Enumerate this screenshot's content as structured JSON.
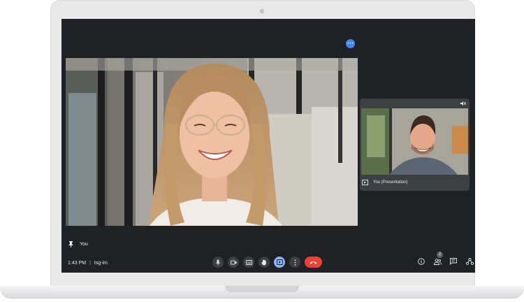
{
  "meeting": {
    "time": "1:43 PM",
    "separator": "|",
    "code": "tsg-im"
  },
  "pinned": {
    "label": "You"
  },
  "self_tile": {
    "caption": "You (Presentation)"
  },
  "people_count": "2",
  "icons": {
    "more": "more-options-icon",
    "pin": "pin-icon",
    "mic": "microphone-icon",
    "camera": "camera-icon",
    "captions": "captions-icon",
    "raise_hand": "raise-hand-icon",
    "present": "present-screen-icon",
    "more_vert": "more-vert-icon",
    "end_call": "end-call-icon",
    "info": "info-icon",
    "people": "people-icon",
    "chat": "chat-icon",
    "activities": "activities-icon",
    "muted": "muted-speaker-icon"
  },
  "colors": {
    "screen_bg": "#202124",
    "tile_bg": "#3c4043",
    "accent_blue": "#8ab4f8",
    "end_call_red": "#ea4335"
  }
}
